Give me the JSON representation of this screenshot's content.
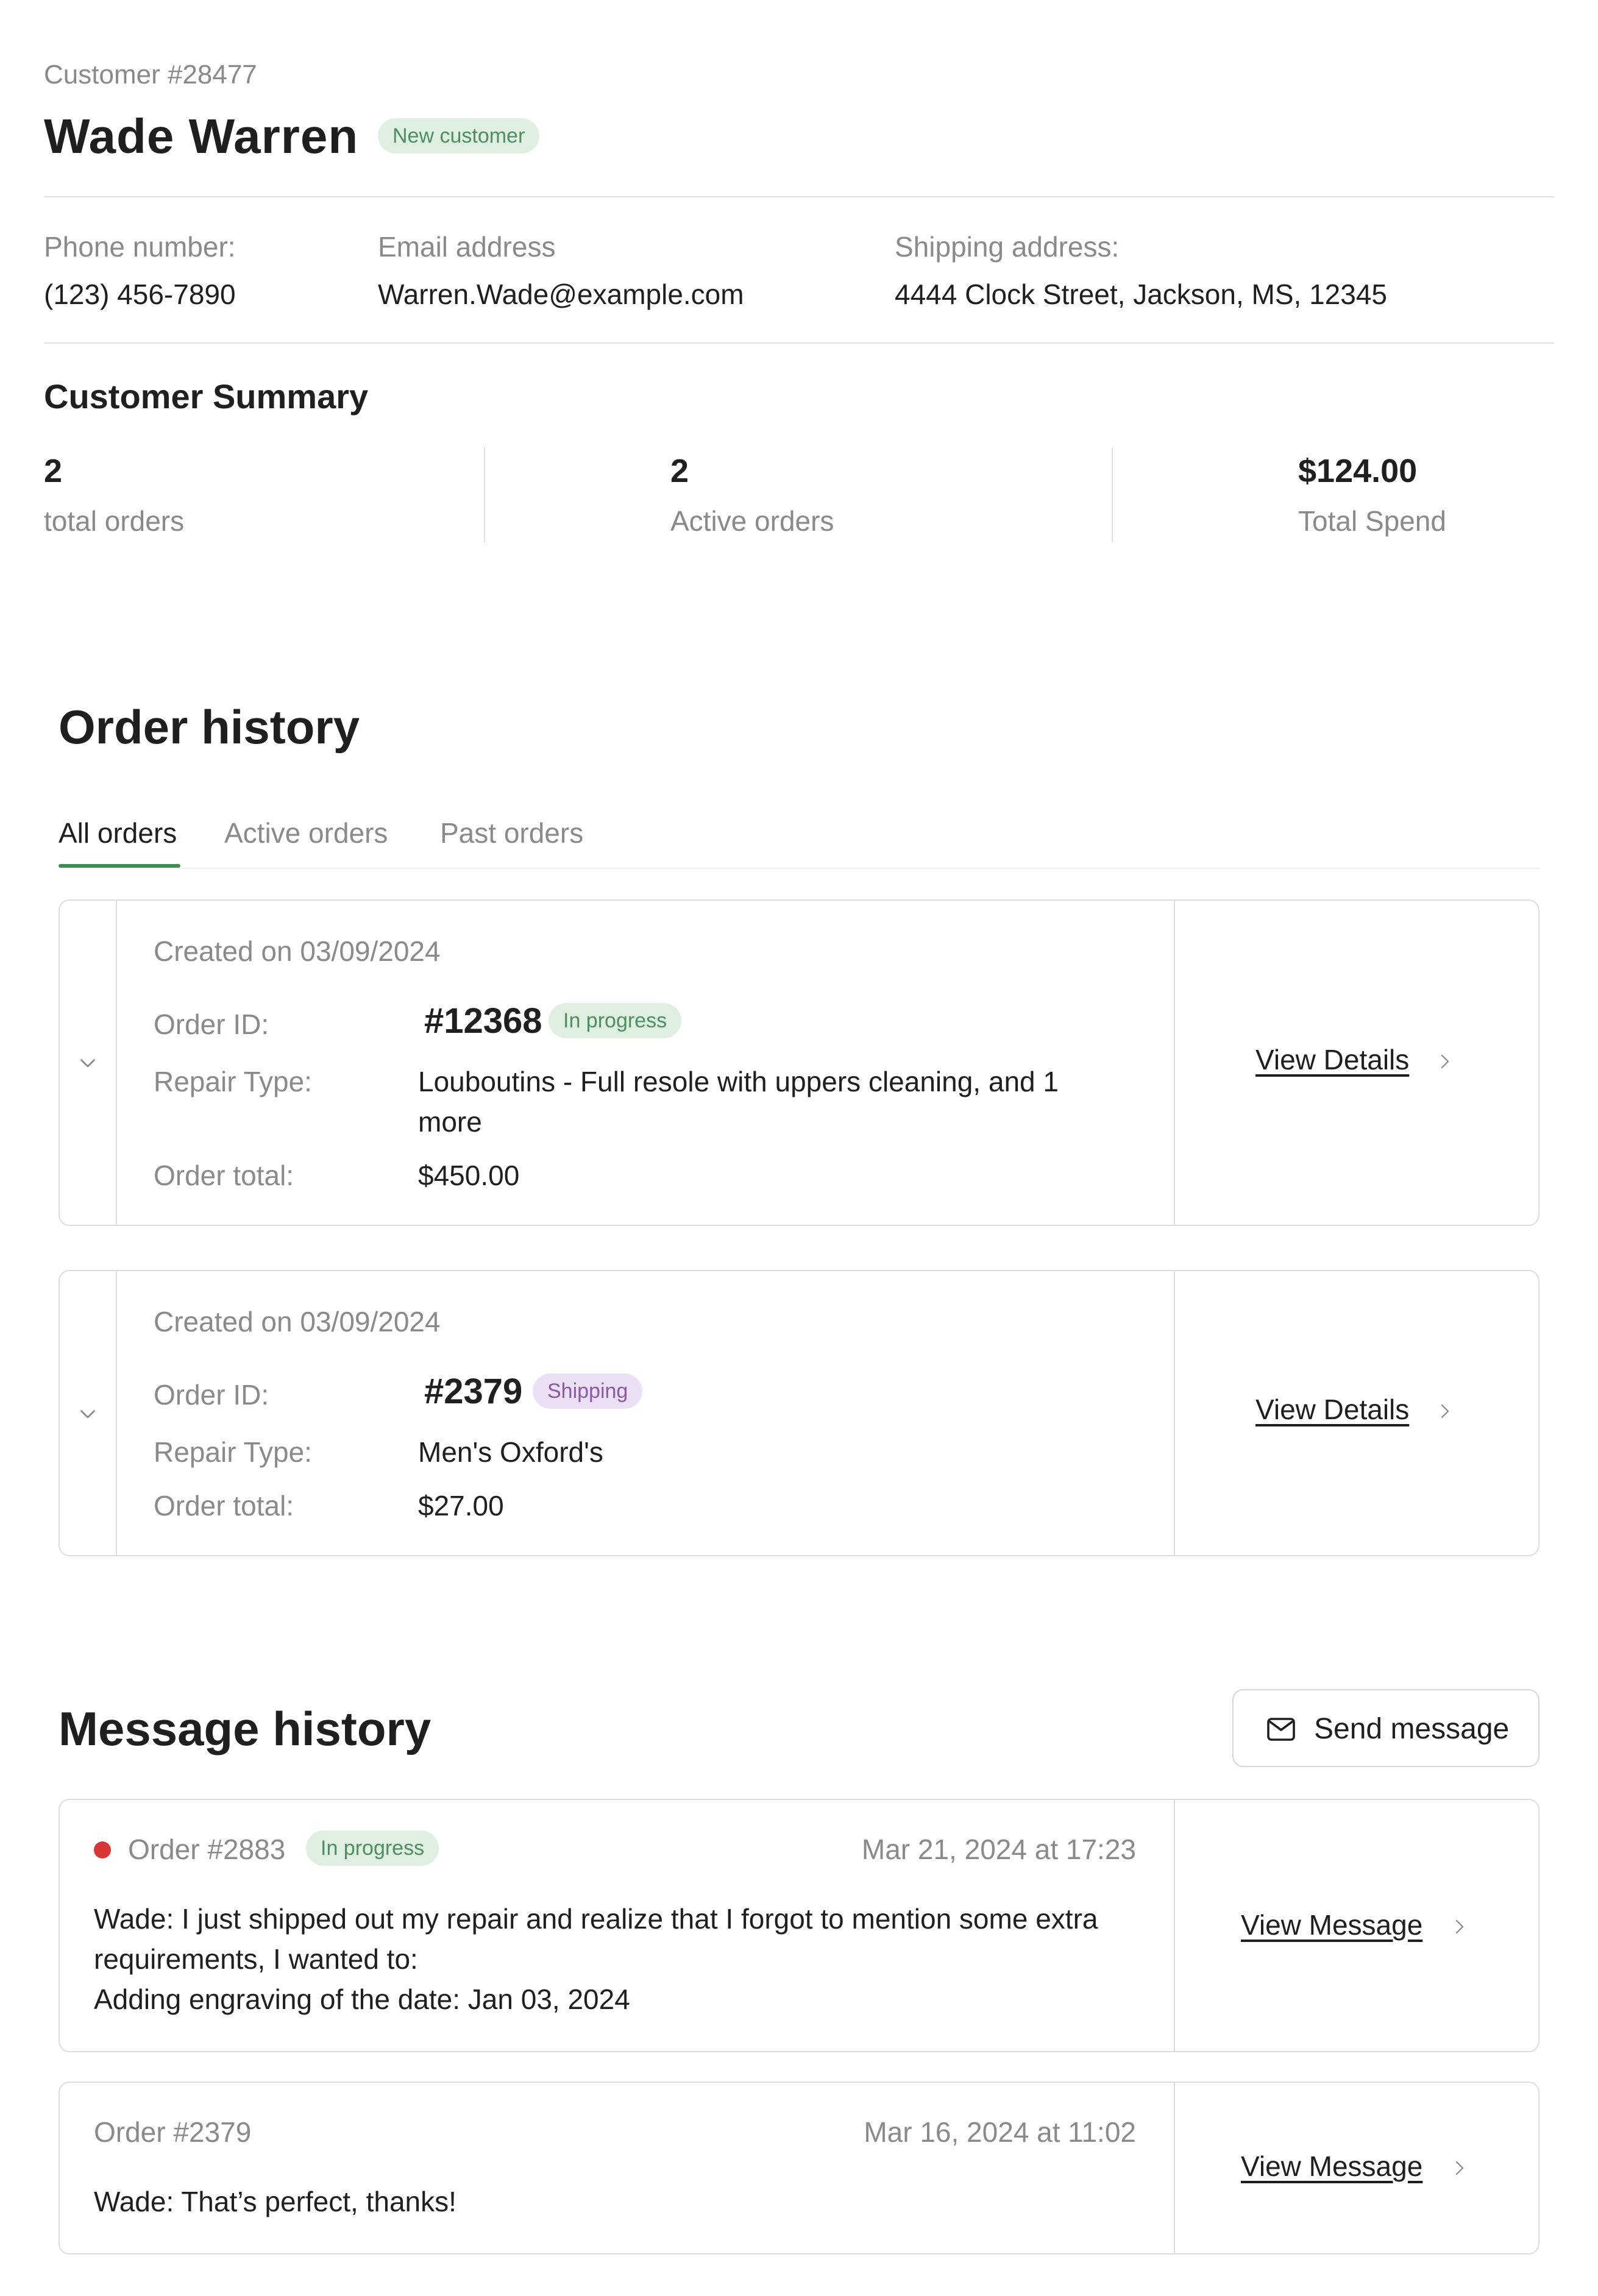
{
  "customer": {
    "number": "Customer #28477",
    "name": "Wade Warren",
    "badge": "New customer"
  },
  "contact": {
    "phone_label": "Phone number:",
    "phone": "(123) 456-7890",
    "email_label": "Email address",
    "email": "Warren.Wade@example.com",
    "address_label": "Shipping address:",
    "address": "4444 Clock Street, Jackson, MS, 12345"
  },
  "summary": {
    "title": "Customer Summary",
    "stats": [
      {
        "value": "2",
        "label": "total orders"
      },
      {
        "value": "2",
        "label": "Active orders"
      },
      {
        "value": "$124.00",
        "label": "Total Spend"
      }
    ]
  },
  "orders": {
    "title": "Order history",
    "tabs": [
      "All orders",
      "Active orders",
      "Past orders"
    ],
    "active_tab": "All orders",
    "labels": {
      "order_id": "Order ID:",
      "repair_type": "Repair Type:",
      "order_total": "Order total:",
      "view_details": "View Details"
    },
    "items": [
      {
        "created": "Created on 03/09/2024",
        "id": "#12368",
        "status": "In progress",
        "status_color": "#dff0e3",
        "repair_type_line1": "Louboutins - Full resole with uppers cleaning, and 1",
        "repair_type_line2": "more",
        "total": "$450.00"
      },
      {
        "created": "Created on 03/09/2024",
        "id": "#2379",
        "status": "Shipping",
        "status_color": "#ece0f6",
        "repair_type_line1": "Men's Oxford's",
        "total": "$27.00"
      }
    ]
  },
  "messages": {
    "title": "Message history",
    "send_label": "Send message",
    "view_label": "View Message",
    "items": [
      {
        "order": "Order #2883",
        "unread": true,
        "status": "In progress",
        "date": "Mar 21, 2024 at 17:23",
        "line1": "Wade: I just shipped out my repair and realize that I forgot to mention some extra",
        "line2": "requirements, I wanted to:",
        "line3": "Adding engraving of the date: Jan 03, 2024"
      },
      {
        "order": "Order #2379",
        "unread": false,
        "date": "Mar 16, 2024 at 11:02",
        "line1": "Wade: That’s perfect, thanks!"
      }
    ]
  },
  "colors": {
    "accent_green": "#3e8e4e",
    "unread_dot": "#d93636"
  }
}
